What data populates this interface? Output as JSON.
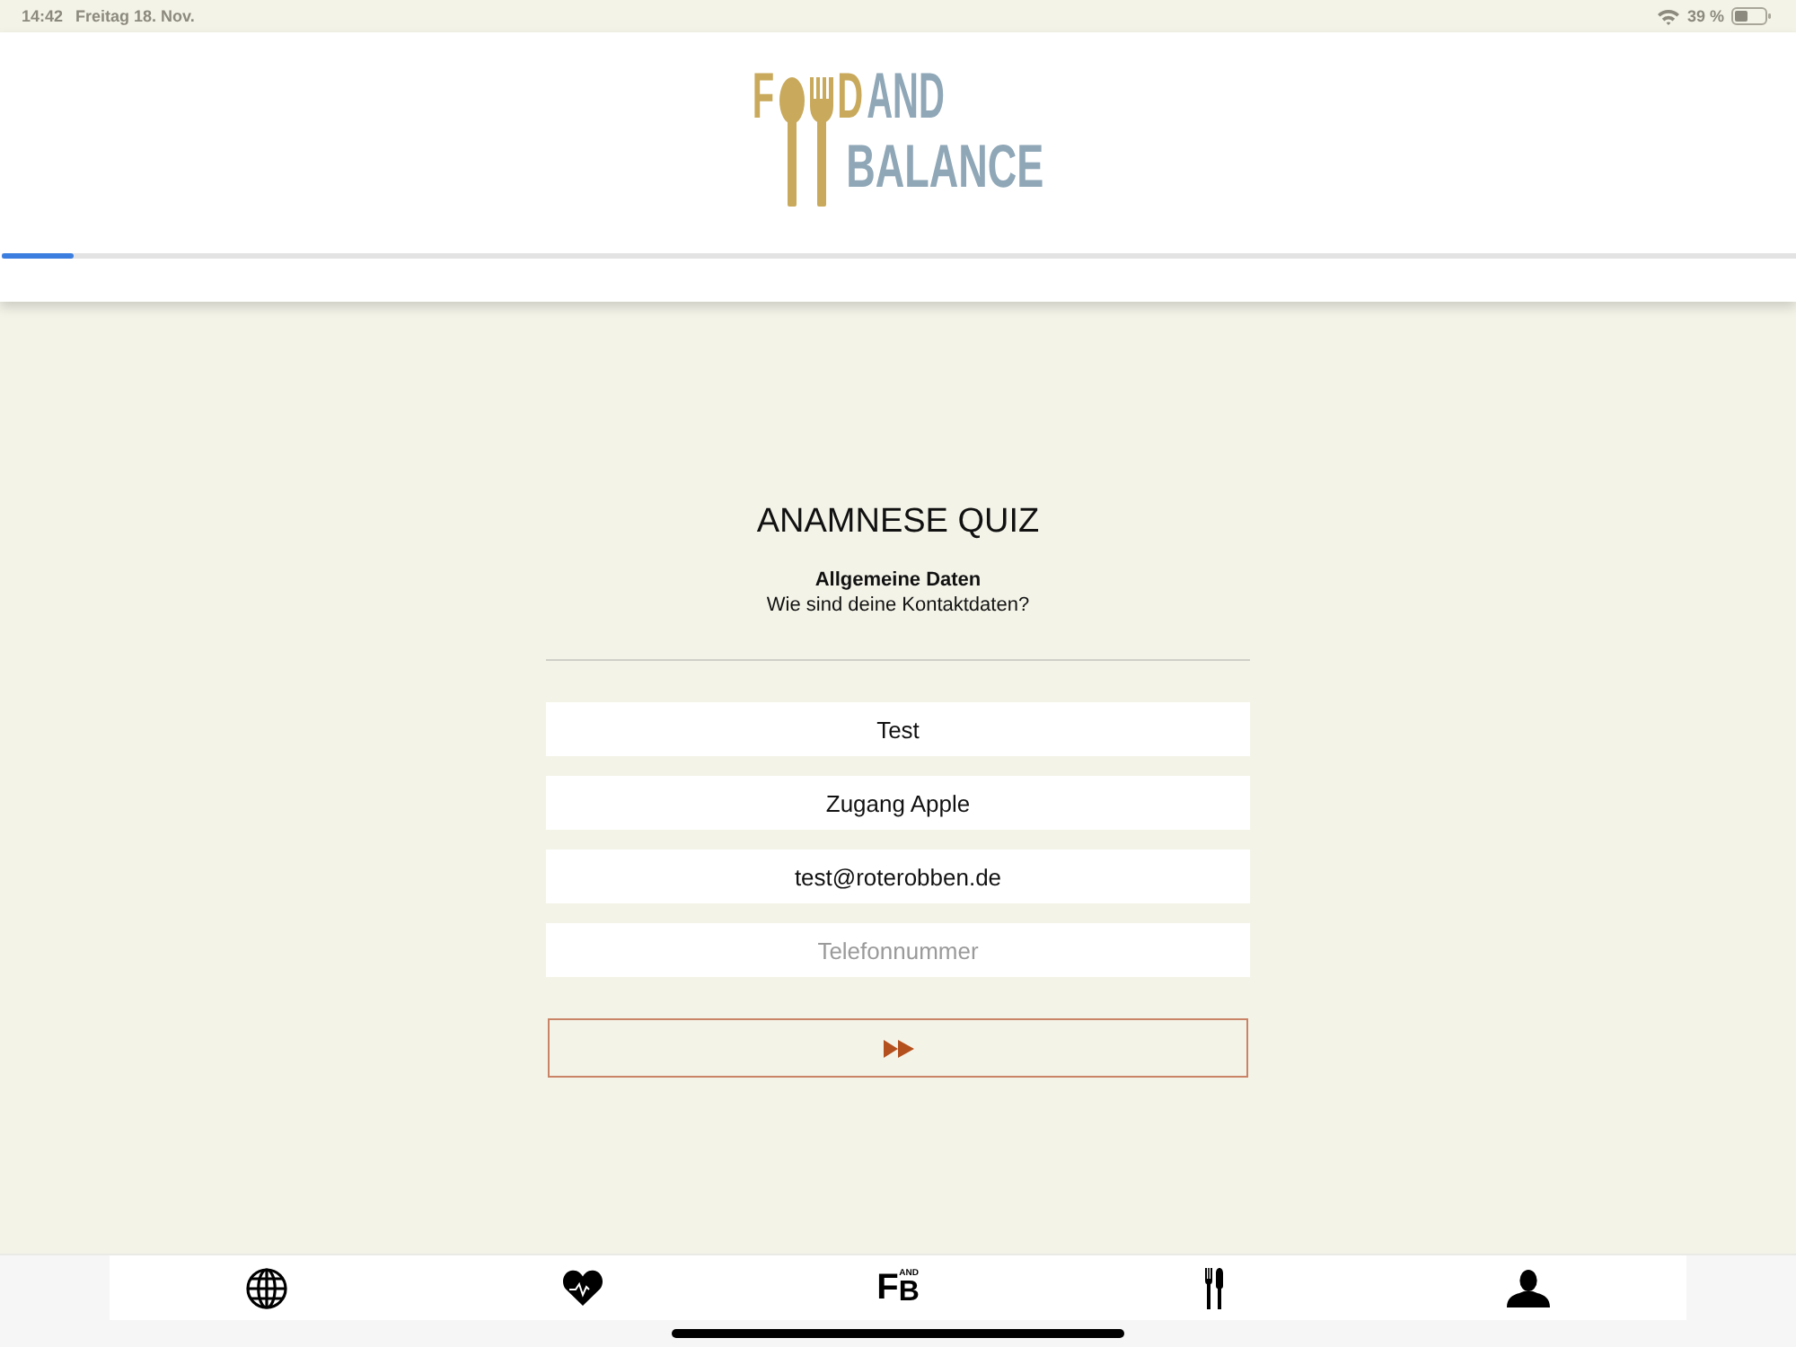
{
  "status_bar": {
    "time": "14:42",
    "date": "Freitag 18. Nov.",
    "battery": "39 %"
  },
  "header": {
    "logo": {
      "food_first_letter": "F",
      "food_last_letter": "D",
      "connector": "AND",
      "line_2": "BALANCE"
    },
    "progress": {
      "level": 0.04
    }
  },
  "quiz": {
    "title": "ANAMNESE QUIZ",
    "section": "Allgemeine Daten",
    "question": "Wie sind deine Kontaktdaten?",
    "fields": [
      {
        "value": "Test"
      },
      {
        "value": "Zugang Apple"
      },
      {
        "value": "test@roterobben.de"
      },
      {
        "placeholder": "Telefonnummer"
      }
    ]
  },
  "tab_bar": {
    "logo_tab": {
      "letter_left": "F",
      "small_word": "AND",
      "letter_right": "B"
    }
  }
}
